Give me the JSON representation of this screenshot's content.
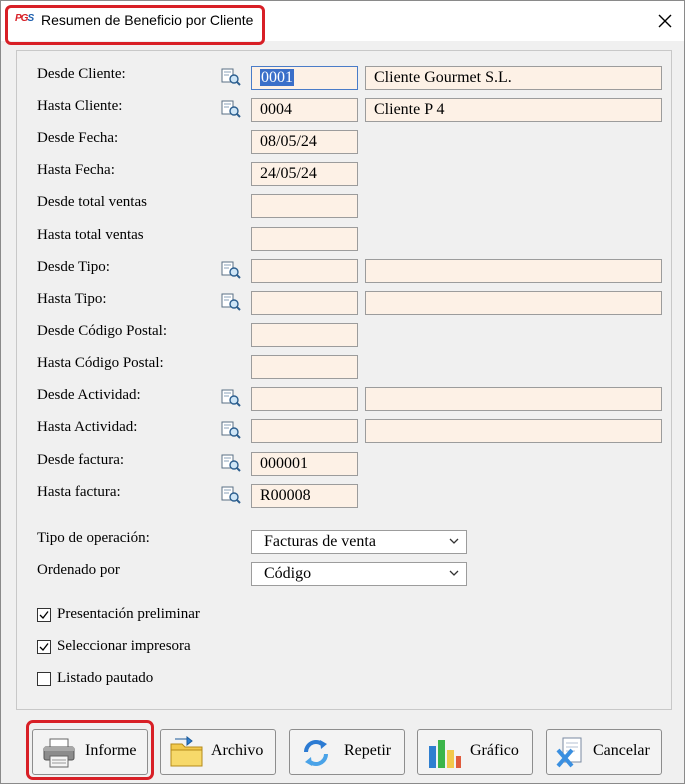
{
  "window": {
    "title": "Resumen de Beneficio por Cliente",
    "logo_left": "PG",
    "logo_right": "S"
  },
  "form": {
    "desde_cliente": {
      "label": "Desde Cliente:",
      "code": "0001",
      "desc": "Cliente Gourmet S.L."
    },
    "hasta_cliente": {
      "label": "Hasta Cliente:",
      "code": "0004",
      "desc": "Cliente P 4"
    },
    "desde_fecha": {
      "label": "Desde Fecha:",
      "value": "08/05/24"
    },
    "hasta_fecha": {
      "label": "Hasta Fecha:",
      "value": "24/05/24"
    },
    "desde_total": {
      "label": "Desde total ventas",
      "value": ""
    },
    "hasta_total": {
      "label": "Hasta total ventas",
      "value": ""
    },
    "desde_tipo": {
      "label": "Desde Tipo:",
      "code": "",
      "desc": ""
    },
    "hasta_tipo": {
      "label": "Hasta Tipo:",
      "code": "",
      "desc": ""
    },
    "desde_cp": {
      "label": "Desde Código Postal:",
      "value": ""
    },
    "hasta_cp": {
      "label": "Hasta Código Postal:",
      "value": ""
    },
    "desde_actividad": {
      "label": "Desde Actividad:",
      "code": "",
      "desc": ""
    },
    "hasta_actividad": {
      "label": "Hasta Actividad:",
      "code": "",
      "desc": ""
    },
    "desde_factura": {
      "label": "Desde factura:",
      "value": "000001"
    },
    "hasta_factura": {
      "label": "Hasta factura:",
      "value": "R00008"
    },
    "tipo_operacion": {
      "label": "Tipo de operación:",
      "value": "Facturas de venta"
    },
    "ordenado_por": {
      "label": "Ordenado por",
      "value": "Código"
    }
  },
  "options": [
    {
      "label": "Presentación preliminar",
      "checked": true
    },
    {
      "label": "Seleccionar impresora",
      "checked": true
    },
    {
      "label": "Listado pautado",
      "checked": false
    }
  ],
  "buttons": {
    "informe": "Informe",
    "archivo": "Archivo",
    "repetir": "Repetir",
    "grafico": "Gráfico",
    "cancelar": "Cancelar"
  },
  "colors": {
    "field_bg": "#fdf1e6",
    "highlight": "#d81f26",
    "selection": "#3a6fc9"
  }
}
